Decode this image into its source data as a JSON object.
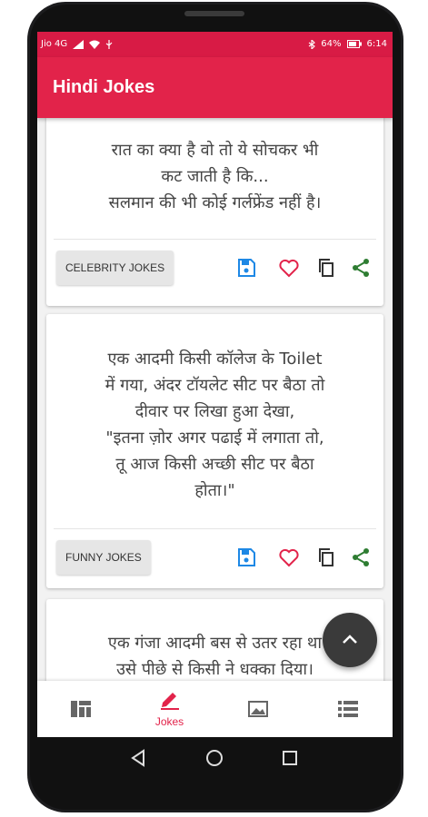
{
  "status_bar": {
    "carrier": "Jio 4G",
    "battery": "64%",
    "time": "6:14"
  },
  "app_bar": {
    "title": "Hindi Jokes"
  },
  "jokes": [
    {
      "text": "रात का क्या है वो तो ये सोचकर भी\nकट जाती है कि...\nसलमान की भी कोई गर्लफ्रेंड नहीं है।",
      "category": "CELEBRITY JOKES"
    },
    {
      "text": "एक आदमी किसी कॉलेज के Toilet\nमें गया, अंदर टॉयलेट सीट पर बैठा तो\nदीवार पर लिखा हुआ देखा,\n\"इतना ज़ोर अगर पढाई में लगाता तो,\nतू आज किसी अच्छी सीट पर बैठा\nहोता।\"",
      "category": "FUNNY JOKES"
    },
    {
      "text": "एक गंजा आदमी बस से उतर रहा था\nउसे पीछे से किसी ने धक्का दिया।"
    }
  ],
  "card_actions": [
    "save-icon",
    "heart-icon",
    "copy-icon",
    "share-icon"
  ],
  "colors": {
    "primary": "#e2234a",
    "save": "#1e88e5",
    "heart": "#e2234a",
    "share": "#2e7d32"
  },
  "bottom_nav": {
    "items": [
      {
        "icon": "dashboard-icon",
        "label": ""
      },
      {
        "icon": "pencil-icon",
        "label": "Jokes",
        "active": true
      },
      {
        "icon": "image-icon",
        "label": ""
      },
      {
        "icon": "list-icon",
        "label": ""
      }
    ]
  },
  "fab": {
    "icon": "chevron-up-icon"
  },
  "system_nav": [
    "back-icon",
    "home-icon",
    "recents-icon"
  ]
}
